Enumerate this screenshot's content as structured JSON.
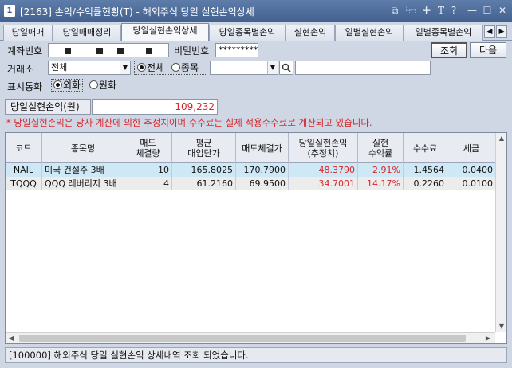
{
  "window": {
    "app_number": "1",
    "title": "[2163] 손익/수익률현황(T) - 해외주식 당일 실현손익상세",
    "controls": [
      "restore-icon",
      "copy-icon",
      "pin-icon",
      "font-icon",
      "help-icon",
      "minimize-icon",
      "maximize-icon",
      "close-icon"
    ],
    "control_glyphs": [
      "⧉",
      "⿻",
      "✚",
      "T",
      "?",
      "—",
      "☐",
      "✕"
    ]
  },
  "tabs": [
    {
      "label": "당일매매",
      "active": false
    },
    {
      "label": "당일매매정리",
      "active": false
    },
    {
      "label": "당일실현손익상세",
      "active": true
    },
    {
      "label": "당일종목별손익",
      "active": false
    },
    {
      "label": "실현손익",
      "active": false
    },
    {
      "label": "일별실현손익",
      "active": false
    },
    {
      "label": "일별종목별손익",
      "active": false
    }
  ],
  "tab_nav": {
    "prev": "◀",
    "next": "▶"
  },
  "form": {
    "account_label": "계좌번호",
    "account_value": "",
    "password_label": "비밀번호",
    "password_value": "*********",
    "exchange_label": "거래소",
    "exchange_value": "전체",
    "scope_options": [
      "전체",
      "종목"
    ],
    "scope_selected": "전체",
    "symbol_value": "",
    "symbol_name_value": "",
    "currency_label": "표시통화",
    "currency_options": [
      "외화",
      "원화"
    ],
    "currency_selected": "외화",
    "query_button": "조회",
    "next_button": "다음"
  },
  "summary": {
    "label": "당일실현손익(원)",
    "value": "109,232"
  },
  "notice": "* 당일실현손익은 당사 계산에 의한 추정치이며 수수료는 실제 적용수수료로 계산되고 있습니다.",
  "table": {
    "columns": [
      "코드",
      "종목명",
      "매도\n체결량",
      "평균\n매입단가",
      "매도체결가",
      "당일실현손익\n(추정치)",
      "실현\n수익률",
      "수수료",
      "세금"
    ],
    "rows": [
      {
        "code": "NAIL",
        "name": "미국 건설주 3배",
        "qty": "10",
        "avg_price": "165.8025",
        "sell_price": "170.7900",
        "pnl": "48.3790",
        "return": "2.91%",
        "fee": "1.4564",
        "tax": "0.0400"
      },
      {
        "code": "TQQQ",
        "name": "QQQ 레버리지 3배",
        "qty": "4",
        "avg_price": "61.2160",
        "sell_price": "69.9500",
        "pnl": "34.7001",
        "return": "14.17%",
        "fee": "0.2260",
        "tax": "0.0100"
      }
    ]
  },
  "status": "[100000] 해외주식 당일 실현손익 상세내역 조회 되었습니다.",
  "colors": {
    "accent": "#d8262b",
    "titlebar": "#4d6b99",
    "selected_row": "#cfe8f6"
  }
}
